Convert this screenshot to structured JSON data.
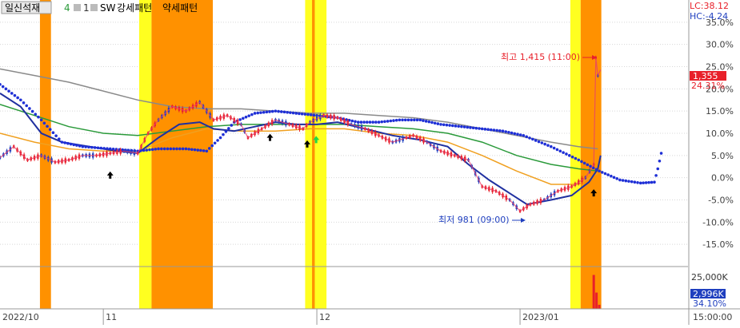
{
  "legend": {
    "series_name": "일신석재",
    "count_a": "4",
    "count_b": "1",
    "sw_label": "SW",
    "strong_pattern": "강세패턴",
    "weak_pattern": "약세패턴"
  },
  "top_right": {
    "lc": "LC:38.12",
    "hc": "HC:-4.24"
  },
  "current": {
    "price": "1,355",
    "change": "24.31%"
  },
  "volume": {
    "value": "2,996K",
    "pct": "34.10%",
    "axis_label": "25,000K"
  },
  "annotations": {
    "high": "최고 1,415 (11:00)",
    "low": "최저 981 (09:00)"
  },
  "x_axis": [
    {
      "label": "2022/10",
      "x": 0.0
    },
    {
      "label": "11",
      "x": 0.15
    },
    {
      "label": "12",
      "x": 0.46
    },
    {
      "label": "2023/01",
      "x": 0.755
    },
    {
      "label": "15:00:00",
      "x": 1.0
    }
  ],
  "colors": {
    "price_up": "#e8202a",
    "price_down": "#1f3fbf",
    "ma_blue": "#2030a0",
    "ma_green": "#2a9a3a",
    "ma_orange": "#f0a020",
    "ma_gray": "#8a8a8a",
    "dotted_blue": "#1e2fd6",
    "band_orange": "#ff9100",
    "band_yellow": "#ffff20",
    "axis_text": "#404040",
    "current_bg": "#e8202a"
  },
  "chart_data": {
    "type": "line",
    "ylabel": "",
    "y_ticks": [
      "35.0%",
      "30.0%",
      "25.0%",
      "20.0%",
      "15.0%",
      "10.0%",
      "5.0%",
      "0.0%",
      "-5.0%",
      "-10.0%",
      "-15.0%"
    ],
    "ylim": [
      -20,
      40
    ],
    "x_range": [
      0,
      1
    ],
    "bands": [
      {
        "x0": 0.058,
        "x1": 0.074,
        "kind": "orange"
      },
      {
        "x0": 0.202,
        "x1": 0.22,
        "kind": "yellow"
      },
      {
        "x0": 0.22,
        "x1": 0.309,
        "kind": "orange"
      },
      {
        "x0": 0.443,
        "x1": 0.453,
        "kind": "yellow"
      },
      {
        "x0": 0.453,
        "x1": 0.457,
        "kind": "orange"
      },
      {
        "x0": 0.457,
        "x1": 0.474,
        "kind": "yellow"
      },
      {
        "x0": 0.828,
        "x1": 0.843,
        "kind": "yellow"
      },
      {
        "x0": 0.843,
        "x1": 0.873,
        "kind": "orange"
      }
    ],
    "series": [
      {
        "key": "price",
        "points": [
          [
            0.0,
            4.5
          ],
          [
            0.02,
            7.0
          ],
          [
            0.04,
            4.0
          ],
          [
            0.06,
            5.0
          ],
          [
            0.08,
            3.5
          ],
          [
            0.1,
            4.0
          ],
          [
            0.12,
            5.0
          ],
          [
            0.14,
            5.0
          ],
          [
            0.16,
            5.5
          ],
          [
            0.18,
            6.0
          ],
          [
            0.2,
            5.5
          ],
          [
            0.215,
            10.0
          ],
          [
            0.23,
            13.0
          ],
          [
            0.25,
            16.0
          ],
          [
            0.27,
            15.0
          ],
          [
            0.29,
            17.0
          ],
          [
            0.31,
            13.0
          ],
          [
            0.33,
            14.0
          ],
          [
            0.35,
            12.0
          ],
          [
            0.36,
            9.0
          ],
          [
            0.38,
            11.0
          ],
          [
            0.4,
            13.0
          ],
          [
            0.42,
            12.0
          ],
          [
            0.44,
            11.0
          ],
          [
            0.45,
            12.5
          ],
          [
            0.47,
            14.0
          ],
          [
            0.49,
            13.5
          ],
          [
            0.51,
            12.0
          ],
          [
            0.53,
            11.0
          ],
          [
            0.55,
            9.5
          ],
          [
            0.57,
            8.0
          ],
          [
            0.59,
            9.0
          ],
          [
            0.6,
            9.5
          ],
          [
            0.62,
            8.0
          ],
          [
            0.64,
            6.0
          ],
          [
            0.66,
            5.0
          ],
          [
            0.68,
            4.0
          ],
          [
            0.7,
            -2.0
          ],
          [
            0.72,
            -3.0
          ],
          [
            0.74,
            -5.0
          ],
          [
            0.755,
            -7.5
          ],
          [
            0.77,
            -6.0
          ],
          [
            0.79,
            -5.0
          ],
          [
            0.81,
            -3.0
          ],
          [
            0.83,
            -2.0
          ],
          [
            0.85,
            0.0
          ],
          [
            0.862,
            3.0
          ],
          [
            0.865,
            27.0
          ],
          [
            0.868,
            23.0
          ],
          [
            0.872,
            24.3
          ]
        ]
      },
      {
        "key": "ma_blue",
        "points": [
          [
            0.0,
            19.0
          ],
          [
            0.03,
            16.0
          ],
          [
            0.06,
            10.0
          ],
          [
            0.09,
            8.0
          ],
          [
            0.13,
            7.0
          ],
          [
            0.17,
            6.0
          ],
          [
            0.2,
            5.5
          ],
          [
            0.23,
            9.0
          ],
          [
            0.26,
            12.0
          ],
          [
            0.29,
            12.5
          ],
          [
            0.31,
            11.0
          ],
          [
            0.34,
            10.5
          ],
          [
            0.37,
            11.5
          ],
          [
            0.4,
            12.5
          ],
          [
            0.43,
            12.0
          ],
          [
            0.46,
            12.0
          ],
          [
            0.49,
            12.5
          ],
          [
            0.53,
            11.0
          ],
          [
            0.57,
            9.5
          ],
          [
            0.61,
            8.5
          ],
          [
            0.65,
            7.0
          ],
          [
            0.68,
            3.0
          ],
          [
            0.71,
            -0.5
          ],
          [
            0.74,
            -3.5
          ],
          [
            0.765,
            -6.0
          ],
          [
            0.8,
            -5.0
          ],
          [
            0.83,
            -4.0
          ],
          [
            0.855,
            -1.0
          ],
          [
            0.868,
            2.0
          ],
          [
            0.872,
            5.0
          ]
        ]
      },
      {
        "key": "ma_orange",
        "points": [
          [
            0.0,
            10.0
          ],
          [
            0.05,
            8.0
          ],
          [
            0.1,
            6.5
          ],
          [
            0.15,
            6.0
          ],
          [
            0.2,
            6.0
          ],
          [
            0.25,
            9.0
          ],
          [
            0.3,
            11.0
          ],
          [
            0.35,
            10.5
          ],
          [
            0.4,
            10.5
          ],
          [
            0.45,
            11.0
          ],
          [
            0.5,
            11.0
          ],
          [
            0.55,
            10.0
          ],
          [
            0.6,
            9.5
          ],
          [
            0.65,
            8.0
          ],
          [
            0.7,
            5.0
          ],
          [
            0.75,
            1.5
          ],
          [
            0.8,
            -1.5
          ],
          [
            0.84,
            -1.5
          ],
          [
            0.868,
            1.0
          ]
        ]
      },
      {
        "key": "ma_green",
        "points": [
          [
            0.0,
            16.5
          ],
          [
            0.05,
            14.0
          ],
          [
            0.1,
            11.5
          ],
          [
            0.15,
            10.0
          ],
          [
            0.2,
            9.5
          ],
          [
            0.25,
            10.5
          ],
          [
            0.3,
            11.5
          ],
          [
            0.35,
            12.0
          ],
          [
            0.4,
            12.0
          ],
          [
            0.45,
            12.0
          ],
          [
            0.5,
            12.0
          ],
          [
            0.55,
            11.5
          ],
          [
            0.6,
            11.0
          ],
          [
            0.65,
            10.0
          ],
          [
            0.7,
            8.0
          ],
          [
            0.75,
            5.0
          ],
          [
            0.8,
            3.0
          ],
          [
            0.84,
            2.0
          ],
          [
            0.868,
            1.5
          ]
        ]
      },
      {
        "key": "ma_gray",
        "points": [
          [
            0.0,
            24.5
          ],
          [
            0.05,
            23.0
          ],
          [
            0.1,
            21.5
          ],
          [
            0.15,
            19.5
          ],
          [
            0.2,
            17.5
          ],
          [
            0.25,
            16.0
          ],
          [
            0.3,
            15.5
          ],
          [
            0.35,
            15.5
          ],
          [
            0.4,
            15.0
          ],
          [
            0.45,
            14.5
          ],
          [
            0.5,
            14.5
          ],
          [
            0.55,
            14.0
          ],
          [
            0.6,
            13.5
          ],
          [
            0.65,
            12.5
          ],
          [
            0.7,
            11.0
          ],
          [
            0.75,
            9.5
          ],
          [
            0.8,
            8.0
          ],
          [
            0.84,
            7.0
          ],
          [
            0.868,
            6.5
          ]
        ]
      },
      {
        "key": "dotted_blue",
        "points": [
          [
            0.0,
            21.0
          ],
          [
            0.03,
            17.5
          ],
          [
            0.06,
            13.0
          ],
          [
            0.09,
            8.0
          ],
          [
            0.12,
            7.0
          ],
          [
            0.16,
            6.5
          ],
          [
            0.2,
            6.0
          ],
          [
            0.23,
            6.5
          ],
          [
            0.27,
            6.5
          ],
          [
            0.3,
            6.0
          ],
          [
            0.32,
            9.0
          ],
          [
            0.34,
            12.5
          ],
          [
            0.37,
            14.5
          ],
          [
            0.4,
            15.0
          ],
          [
            0.43,
            14.5
          ],
          [
            0.46,
            14.0
          ],
          [
            0.49,
            13.5
          ],
          [
            0.52,
            12.5
          ],
          [
            0.55,
            12.5
          ],
          [
            0.58,
            13.0
          ],
          [
            0.61,
            13.0
          ],
          [
            0.64,
            12.0
          ],
          [
            0.67,
            11.5
          ],
          [
            0.7,
            11.0
          ],
          [
            0.73,
            10.5
          ],
          [
            0.76,
            9.5
          ],
          [
            0.8,
            7.0
          ],
          [
            0.84,
            4.0
          ],
          [
            0.87,
            1.5
          ],
          [
            0.9,
            -0.5
          ],
          [
            0.93,
            -1.2
          ],
          [
            0.95,
            -1.0
          ],
          [
            0.955,
            2.0
          ],
          [
            0.96,
            5.5
          ]
        ]
      }
    ],
    "markers": [
      {
        "x": 0.16,
        "y": 0.5,
        "type": "black-arrow"
      },
      {
        "x": 0.392,
        "y": 9.0,
        "type": "black-arrow"
      },
      {
        "x": 0.446,
        "y": 7.5,
        "type": "black-arrow"
      },
      {
        "x": 0.459,
        "y": 8.5,
        "type": "green-arrow"
      },
      {
        "x": 0.862,
        "y": -3.5,
        "type": "black-arrow"
      }
    ],
    "volume": {
      "ylim": [
        0,
        30000
      ],
      "bars": [
        [
          0.862,
          25000
        ],
        [
          0.866,
          12000
        ],
        [
          0.87,
          3000
        ]
      ]
    }
  }
}
